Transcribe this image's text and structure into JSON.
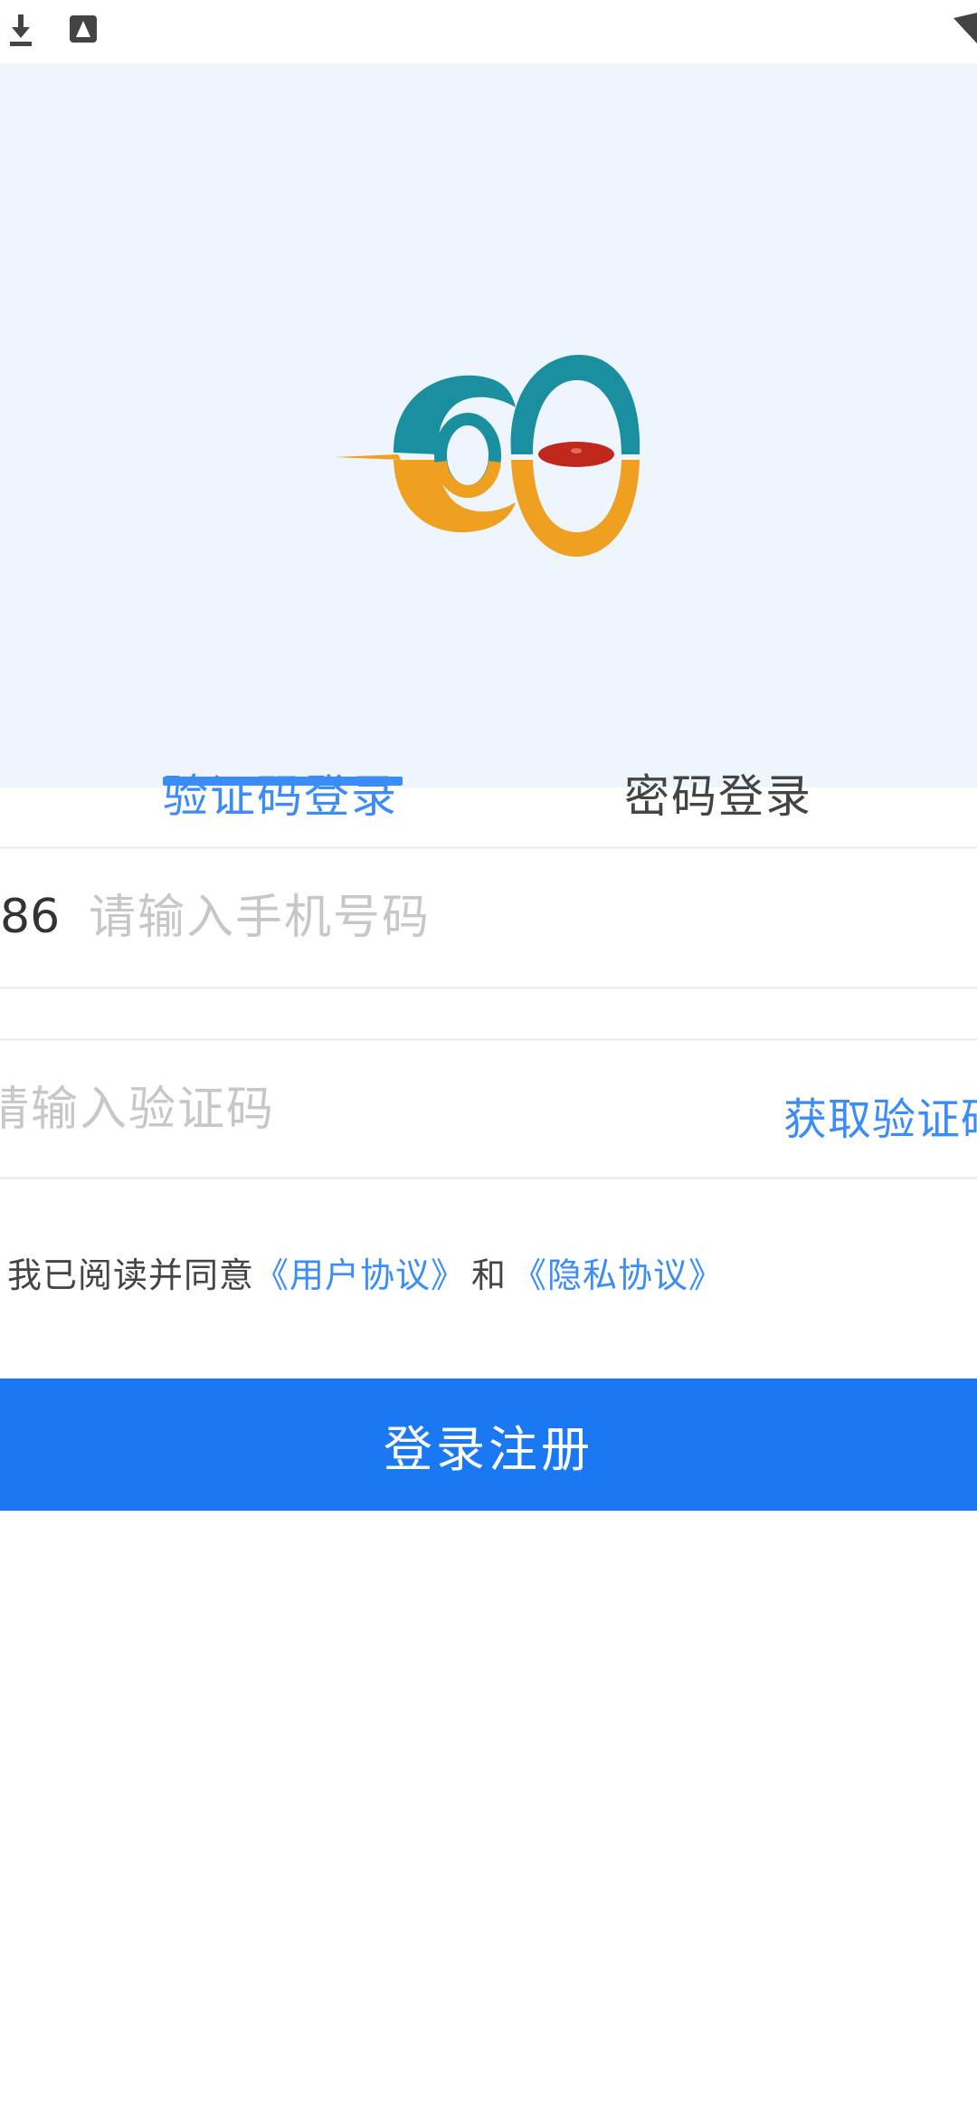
{
  "status_bar": {
    "icons": [
      "download-icon",
      "app-icon",
      "wifi-icon"
    ]
  },
  "logo": {
    "name": "app-logo",
    "colors": {
      "teal": "#1a8fa0",
      "orange": "#f0a020",
      "red": "#c0281e"
    }
  },
  "tabs": [
    {
      "label": "验证码登录",
      "active": true
    },
    {
      "label": "密码登录",
      "active": false
    }
  ],
  "phone": {
    "prefix": "86",
    "placeholder": "请输入手机号码",
    "value": ""
  },
  "code": {
    "placeholder": "请输入验证码",
    "value": "",
    "get_code_label": "获取验证码"
  },
  "agreement": {
    "prefix": "我已阅读并同意",
    "user_agreement": "《用户协议》",
    "and": "和",
    "privacy_agreement": "《隐私协议》"
  },
  "login_button": {
    "label": "登录注册"
  },
  "colors": {
    "accent": "#3b8cf6",
    "button": "#1a78f2",
    "hero_background": "#eef5fd"
  }
}
